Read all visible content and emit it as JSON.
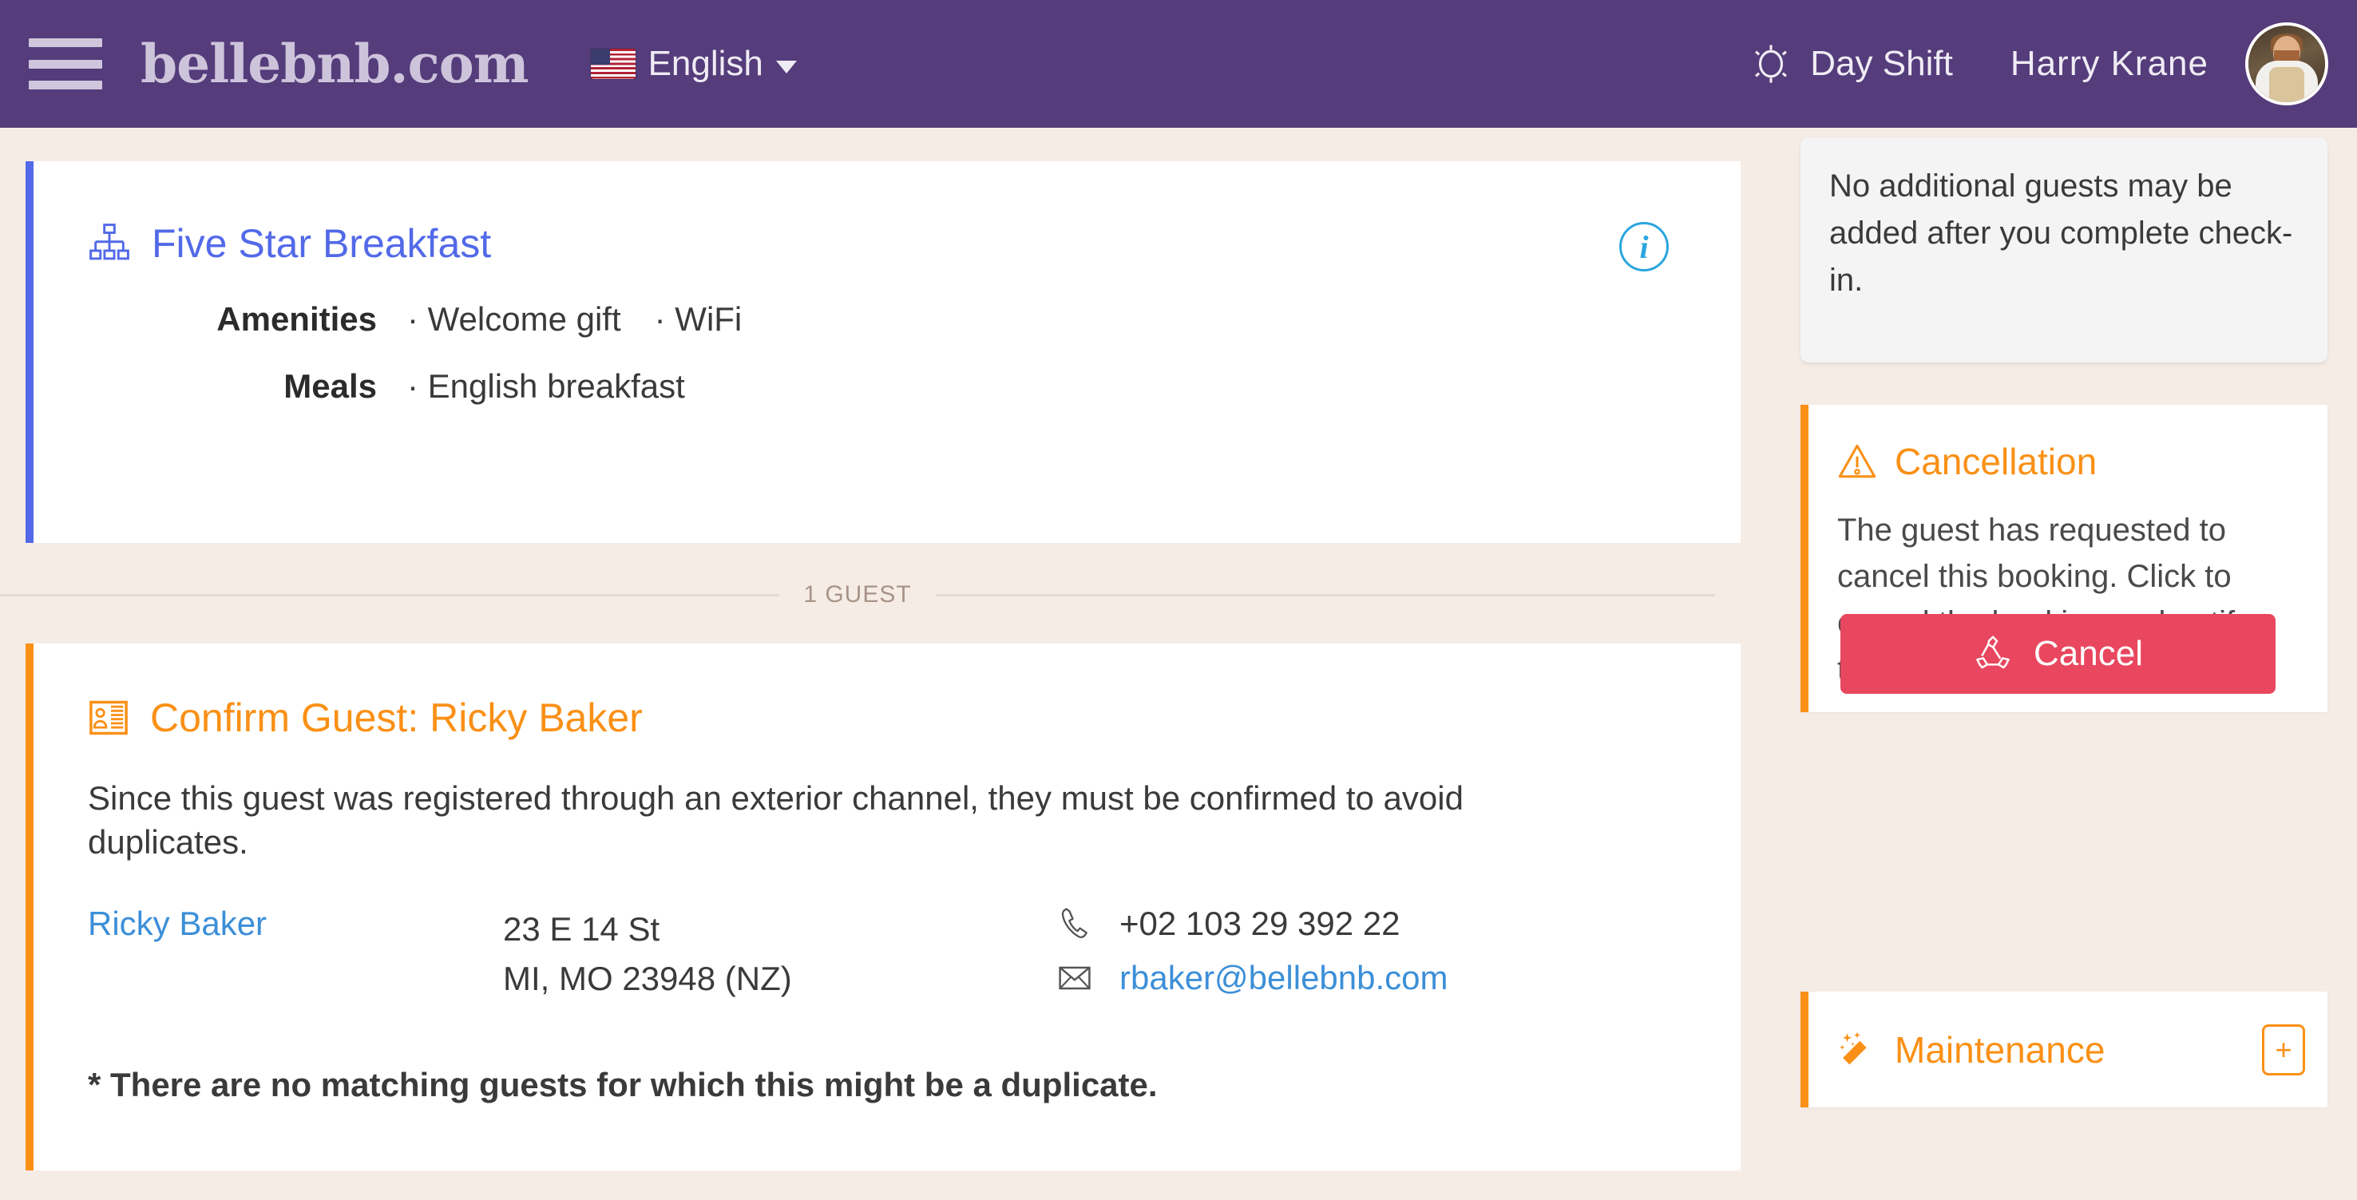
{
  "header": {
    "menu_icon": "hamburger-icon",
    "brand": "bellebnb.com",
    "language": {
      "flag": "us-flag-icon",
      "label": "English",
      "caret": "chevron-down-icon"
    },
    "shift": {
      "icon": "sun-icon",
      "label": "Day Shift"
    },
    "user": {
      "name": "Harry Krane",
      "avatar": "user-avatar"
    },
    "bar_color": "#553c7b"
  },
  "main": {
    "rate_card": {
      "icon": "sitemap-icon",
      "title": "Five Star Breakfast",
      "accent_color": "#5269e8",
      "info_icon": "info-icon",
      "rows": [
        {
          "label": "Amenities",
          "values": [
            "· Welcome gift",
            "· WiFi"
          ]
        },
        {
          "label": "Meals",
          "values": [
            "· English breakfast"
          ]
        }
      ]
    },
    "guest_divider_label": "1 GUEST",
    "guest_card": {
      "icon": "id-card-icon",
      "title": "Confirm Guest: Ricky Baker",
      "accent_color": "#fa9016",
      "description": "Since this guest was registered through an exterior channel, they must be confirmed to avoid duplicates.",
      "guest": {
        "name": "Ricky Baker",
        "address_line1": "23 E 14 St",
        "address_line2": "MI, MO 23948 (NZ)",
        "phone_icon": "phone-icon",
        "phone": "+02 103 29 392 22",
        "email_icon": "envelope-icon",
        "email": "rbaker@bellebnb.com"
      },
      "duplicate_note": "* There are no matching guests for which this might be a duplicate."
    }
  },
  "sidebar": {
    "notice": "No additional guests may be added after you complete check-in.",
    "cancellation": {
      "icon": "warning-triangle-icon",
      "title": "Cancellation",
      "body": "The guest has requested to cancel this booking. Click to cancel the booking and notify the guest.",
      "button_icon": "recycle-icon",
      "button_label": "Cancel",
      "button_color": "#e8475f"
    },
    "maintenance": {
      "icon": "magic-wand-icon",
      "title": "Maintenance",
      "add_label": "+"
    },
    "accent_color": "#fa9016"
  }
}
